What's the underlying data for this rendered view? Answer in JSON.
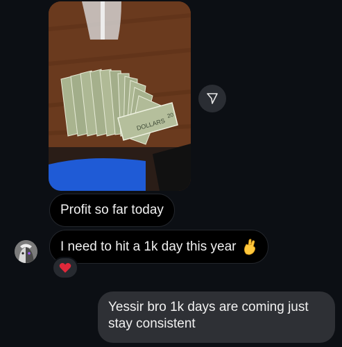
{
  "thread": {
    "messages": [
      {
        "text": "Profit so far today",
        "sender": "other"
      },
      {
        "text": "I need to hit a 1k day this year",
        "emoji": "crossed-fingers",
        "sender": "other",
        "reaction": "red-heart"
      },
      {
        "text": "Yessir bro 1k days are coming just stay consistent",
        "sender": "me"
      }
    ],
    "photo": {
      "subject": "cash-fanned-on-table-icon"
    },
    "colors": {
      "background": "#0c0f14",
      "incoming_bubble": "#000000",
      "outgoing_bubble": "#2e3035",
      "reaction_heart": "#e0283a"
    }
  }
}
